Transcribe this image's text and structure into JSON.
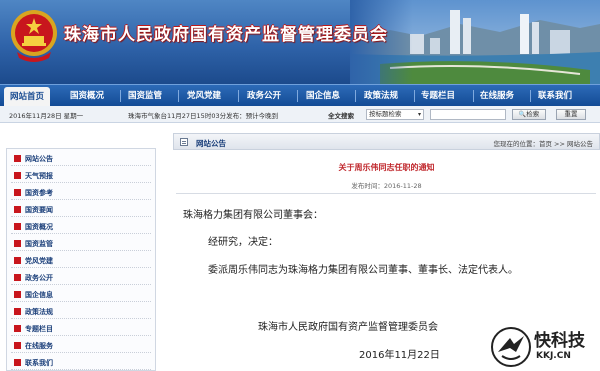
{
  "header": {
    "site_title": "珠海市人民政府国有资产监督管理委员会"
  },
  "nav": {
    "items": [
      {
        "label": "网站首页",
        "active": true
      },
      {
        "label": "国资概况"
      },
      {
        "label": "国资监管"
      },
      {
        "label": "党风党建"
      },
      {
        "label": "政务公开"
      },
      {
        "label": "国企信息"
      },
      {
        "label": "政策法规"
      },
      {
        "label": "专题栏目"
      },
      {
        "label": "在线服务"
      },
      {
        "label": "联系我们"
      }
    ]
  },
  "infobar": {
    "date": "2016年11月28日 星期一",
    "weather": "珠海市气象台11月27日15时03分发布：预计今晚到",
    "search_label": "全文搜索",
    "search_option": "按标题检索",
    "search_button": "检索",
    "reset_button": "重置"
  },
  "sidebar": {
    "items": [
      "网站公告",
      "天气预报",
      "国资参考",
      "国资要闻",
      "国资概况",
      "国资监管",
      "党风党建",
      "政务公开",
      "国企信息",
      "政策法规",
      "专题栏目",
      "在线服务",
      "联系我们"
    ]
  },
  "main": {
    "section_title": "网站公告",
    "breadcrumb": "您现在的位置：首页 >> 网站公告",
    "article_title": "关于周乐伟同志任职的通知",
    "article_meta": "发布时间：2016-11-28",
    "paragraphs": {
      "salutation": "珠海格力集团有限公司董事会：",
      "p1": "经研究，决定：",
      "p2": "委派周乐伟同志为珠海格力集团有限公司董事、董事长、法定代表人。",
      "signature": "珠海市人民政府国有资产监督管理委员会",
      "date": "2016年11月22日"
    }
  },
  "watermark": {
    "name": "快科技",
    "url": "KKJ.CN"
  },
  "colors": {
    "banner": "#2f63a9",
    "nav": "#134b95",
    "title_red": "#c0282d",
    "bullet_red": "#c8161d"
  }
}
